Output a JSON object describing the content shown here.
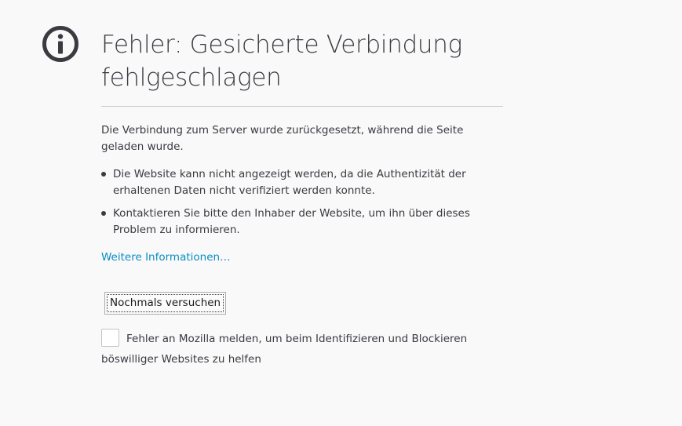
{
  "error": {
    "title": "Fehler: Gesicherte Verbindung fehlgeschlagen",
    "description": "Die Verbindung zum Server wurde zurückgesetzt, während die Seite geladen wurde.",
    "bullets": [
      "Die Website kann nicht angezeigt werden, da die Authentizität der erhaltenen Daten nicht verifiziert werden konnte.",
      "Kontaktieren Sie bitte den Inhaber der Website, um ihn über dieses Problem zu informieren."
    ],
    "more_info_link": "Weitere Informationen…",
    "retry_button": "Nochmals versuchen",
    "report_label": "Fehler an Mozilla melden, um beim Identifizieren und Blockieren böswilliger Websites zu helfen",
    "report_checked": false
  },
  "colors": {
    "background": "#f9f9fa",
    "text": "#3a3a40",
    "link": "#0a8dc2",
    "icon": "#3a3a40"
  },
  "icons": {
    "header": "info-circle-icon"
  }
}
